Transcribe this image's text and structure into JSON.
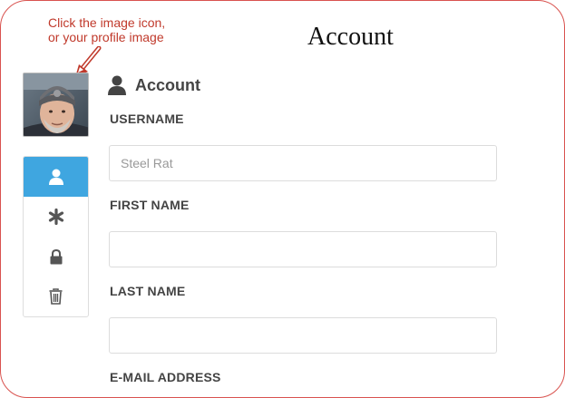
{
  "annotation": {
    "line1": "Click the image icon,",
    "line2": "or your profile image",
    "color": "#c0392b"
  },
  "page": {
    "title": "Account"
  },
  "profile": {
    "avatar_icon": "profile-photo"
  },
  "sidenav": {
    "items": [
      {
        "icon": "user-icon",
        "active": true
      },
      {
        "icon": "asterisk-icon",
        "active": false
      },
      {
        "icon": "lock-icon",
        "active": false
      },
      {
        "icon": "trash-icon",
        "active": false
      }
    ],
    "active_color": "#3fa6e0"
  },
  "section": {
    "icon": "user-icon",
    "title": "Account"
  },
  "form": {
    "username_label": "USERNAME",
    "username_placeholder": "Steel Rat",
    "username_value": "",
    "first_name_label": "FIRST NAME",
    "first_name_value": "",
    "last_name_label": "LAST NAME",
    "last_name_value": "",
    "email_label": "E-MAIL ADDRESS"
  }
}
